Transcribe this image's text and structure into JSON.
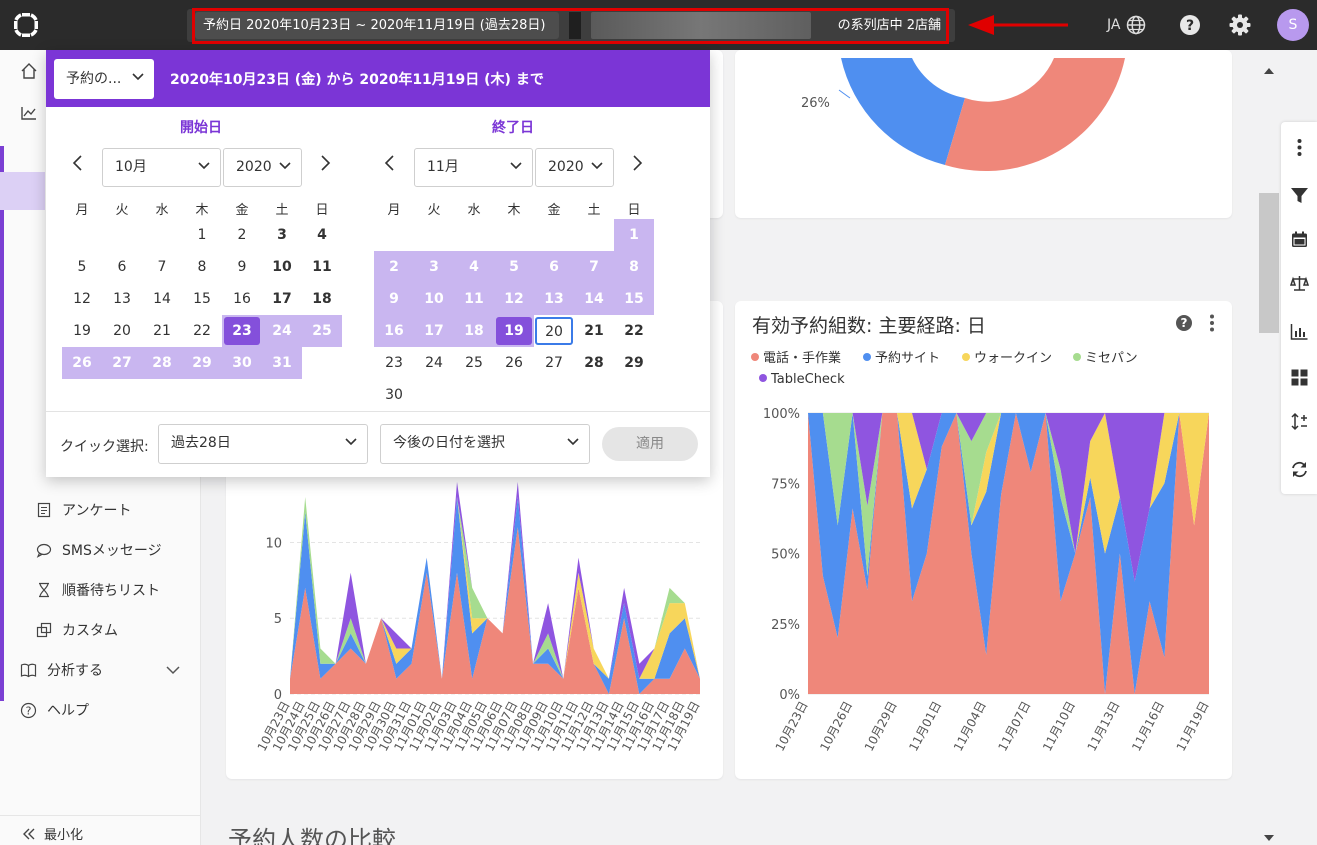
{
  "header": {
    "date_filter": "予約日 2020年10月23日 ~ 2020年11月19日 (過去28日)",
    "store_filter": "の系列店中 2店舗",
    "language": "JA",
    "avatar_initial": "S"
  },
  "sidebar": {
    "items": [
      {
        "label": "アンケート",
        "icon": "document-icon"
      },
      {
        "label": "SMSメッセージ",
        "icon": "chat-icon"
      },
      {
        "label": "順番待ちリスト",
        "icon": "hourglass-icon"
      },
      {
        "label": "カスタム",
        "icon": "custom-icon"
      }
    ],
    "analyze_label": "分析する",
    "help_label": "ヘルプ",
    "minimize_label": "最小化"
  },
  "date_picker": {
    "mode": "予約の...",
    "range_text": "2020年10月23日 (金) から 2020年11月19日 (木) まで",
    "start_label": "開始日",
    "end_label": "終了日",
    "weekdays": [
      "月",
      "火",
      "水",
      "木",
      "金",
      "土",
      "日"
    ],
    "start_month": "10月",
    "start_year": "2020",
    "end_month": "11月",
    "end_year": "2020",
    "quick_select_label": "クイック選択:",
    "quick_select_value": "過去28日",
    "future_select_value": "今後の日付を選択",
    "apply_label": "適用"
  },
  "donut_card": {
    "percent_label": "26%"
  },
  "left_chart": {
    "yticks": [
      "0",
      "5",
      "10"
    ]
  },
  "right_chart": {
    "title": "有効予約組数: 主要経路: 日",
    "legend": [
      {
        "label": "電話・手作業",
        "color": "#ef877a"
      },
      {
        "label": "予約サイト",
        "color": "#4f8ff0"
      },
      {
        "label": "ウォークイン",
        "color": "#f7d65b"
      },
      {
        "label": "ミセパン",
        "color": "#a6dc8f"
      },
      {
        "label": "TableCheck",
        "color": "#8f55e0"
      }
    ],
    "yticks": [
      "0%",
      "25%",
      "50%",
      "75%",
      "100%"
    ]
  },
  "chart_data": [
    {
      "type": "area",
      "stacked": true,
      "x": [
        "10月23日",
        "10月24日",
        "10月25日",
        "10月26日",
        "10月27日",
        "10月28日",
        "10月29日",
        "10月30日",
        "10月31日",
        "11月01日",
        "11月02日",
        "11月03日",
        "11月04日",
        "11月05日",
        "11月06日",
        "11月07日",
        "11月08日",
        "11月09日",
        "11月10日",
        "11月11日",
        "11月12日",
        "11月13日",
        "11月14日",
        "11月15日",
        "11月16日",
        "11月17日",
        "11月18日",
        "11月19日"
      ],
      "series": [
        {
          "name": "電話・手作業",
          "values": [
            1,
            7,
            1,
            2,
            3,
            2,
            5,
            1,
            2,
            8,
            1,
            8,
            1,
            5,
            4,
            11,
            2,
            2,
            1,
            7,
            2,
            0,
            5,
            0,
            1,
            1,
            3,
            1
          ]
        },
        {
          "name": "予約サイト",
          "values": [
            0,
            5,
            1,
            0,
            1,
            0,
            0,
            1,
            1,
            1,
            0,
            5,
            3,
            0,
            0,
            2,
            0,
            1,
            0,
            0,
            0,
            1,
            1,
            1,
            0,
            3,
            2,
            0
          ]
        },
        {
          "name": "ウォークイン",
          "values": [
            0,
            0,
            0,
            0,
            0,
            0,
            0,
            1,
            0,
            0,
            0,
            0,
            1,
            0,
            0,
            0,
            0,
            0,
            0,
            1,
            1,
            0,
            0,
            0,
            2,
            2,
            1,
            0
          ]
        },
        {
          "name": "ミセパン",
          "values": [
            0,
            1,
            1,
            0,
            1,
            0,
            0,
            0,
            0,
            0,
            0,
            0,
            2,
            0,
            0,
            0,
            0,
            1,
            0,
            0,
            0,
            0,
            0,
            0,
            0,
            1,
            0,
            0
          ]
        },
        {
          "name": "TableCheck",
          "values": [
            0,
            0,
            0,
            0,
            3,
            0,
            0,
            1,
            0,
            0,
            0,
            1,
            0,
            0,
            0,
            1,
            0,
            2,
            0,
            1,
            0,
            0,
            1,
            1,
            0,
            0,
            0,
            0
          ]
        }
      ],
      "ylim": [
        0,
        16.5
      ],
      "yticks": [
        0,
        5,
        10
      ]
    },
    {
      "type": "area",
      "stacked": true,
      "normalized": true,
      "title": "有効予約組数: 主要経路: 日",
      "x": [
        "10月23日",
        "10月24日",
        "10月25日",
        "10月26日",
        "10月27日",
        "10月28日",
        "10月29日",
        "10月30日",
        "10月31日",
        "11月01日",
        "11月02日",
        "11月03日",
        "11月04日",
        "11月05日",
        "11月06日",
        "11月07日",
        "11月08日",
        "11月09日",
        "11月10日",
        "11月11日",
        "11月12日",
        "11月13日",
        "11月14日",
        "11月15日",
        "11月16日",
        "11月17日",
        "11月18日",
        "11月19日"
      ],
      "xticks": [
        "10月23日",
        "10月26日",
        "10月29日",
        "11月01日",
        "11月04日",
        "11月07日",
        "11月10日",
        "11月13日",
        "11月16日",
        "11月19日"
      ],
      "series": [
        {
          "name": "電話・手作業",
          "values": [
            100,
            42,
            20,
            66,
            37,
            100,
            100,
            33,
            50,
            88,
            100,
            50,
            14,
            71,
            100,
            79,
            100,
            33,
            50,
            70,
            0,
            50,
            0,
            33,
            13,
            100,
            60,
            100
          ]
        },
        {
          "name": "予約サイト",
          "values": [
            0,
            58,
            40,
            34,
            5,
            0,
            0,
            33,
            30,
            12,
            0,
            10,
            58,
            29,
            0,
            21,
            0,
            37,
            0,
            7,
            50,
            20,
            40,
            33,
            62,
            0,
            0,
            0
          ]
        },
        {
          "name": "ウォークイン",
          "values": [
            0,
            0,
            0,
            0,
            0,
            0,
            0,
            34,
            0,
            0,
            0,
            0,
            14,
            0,
            0,
            0,
            0,
            0,
            0,
            13,
            50,
            0,
            0,
            0,
            25,
            0,
            40,
            0
          ]
        },
        {
          "name": "ミセパン",
          "values": [
            0,
            0,
            40,
            0,
            25,
            0,
            0,
            0,
            0,
            0,
            0,
            30,
            14,
            0,
            0,
            0,
            0,
            10,
            0,
            0,
            0,
            0,
            0,
            0,
            0,
            0,
            0,
            0
          ]
        },
        {
          "name": "TableCheck",
          "values": [
            0,
            0,
            0,
            0,
            33,
            0,
            0,
            0,
            20,
            0,
            0,
            10,
            0,
            0,
            0,
            0,
            0,
            20,
            50,
            10,
            0,
            30,
            60,
            34,
            0,
            0,
            0,
            0
          ]
        }
      ],
      "ylim": [
        0,
        100
      ],
      "yticks": [
        "0%",
        "25%",
        "50%",
        "75%",
        "100%"
      ]
    }
  ]
}
